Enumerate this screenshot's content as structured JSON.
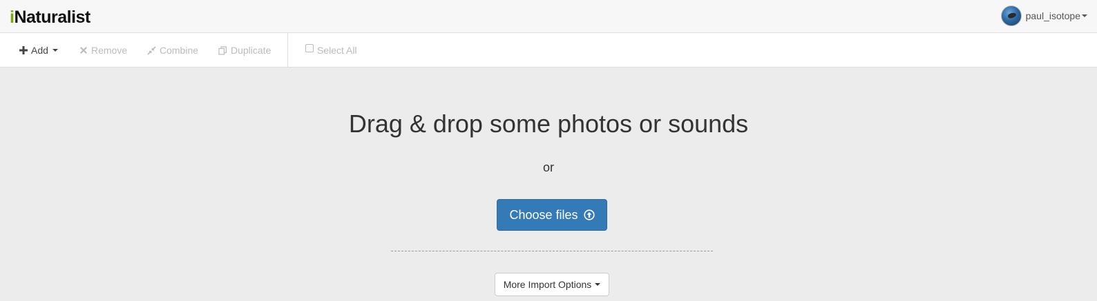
{
  "header": {
    "logo_i": "i",
    "logo_rest": "Naturalist",
    "username": "paul_isotope"
  },
  "toolbar": {
    "add_label": "Add",
    "remove_label": "Remove",
    "combine_label": "Combine",
    "duplicate_label": "Duplicate",
    "select_all_label": "Select All"
  },
  "dropzone": {
    "headline": "Drag & drop some photos or sounds",
    "or_text": "or",
    "choose_files_label": "Choose files",
    "more_import_label": "More Import Options"
  },
  "colors": {
    "brand_green": "#74ac00",
    "primary_button": "#337ab7",
    "disabled_text": "#bbbbbb"
  },
  "icons": {
    "add": "plus-icon",
    "remove": "x-icon",
    "combine": "compress-icon",
    "duplicate": "copy-icon",
    "choose_files": "upload-circle-icon"
  }
}
